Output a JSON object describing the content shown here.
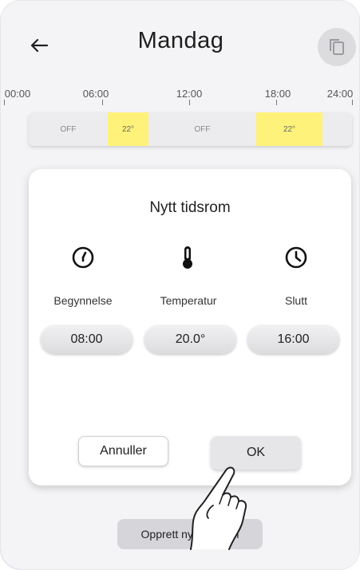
{
  "header": {
    "title": "Mandag"
  },
  "timeline": {
    "ticks": [
      "00:00",
      "06:00",
      "12:00",
      "18:00",
      "24:00"
    ],
    "segments": [
      {
        "label": "OFF",
        "state": "off"
      },
      {
        "label": "22°",
        "state": "on"
      },
      {
        "label": "OFF",
        "state": "off"
      },
      {
        "label": "22°",
        "state": "on"
      },
      {
        "label": "",
        "state": "off"
      }
    ]
  },
  "dialog": {
    "title": "Nytt tidsrom",
    "start": {
      "label": "Begynnelse",
      "value": "08:00",
      "icon": "clock-start-icon"
    },
    "temperature": {
      "label": "Temperatur",
      "value": "20.0°",
      "icon": "thermometer-icon"
    },
    "end": {
      "label": "Slutt",
      "value": "16:00",
      "icon": "clock-end-icon"
    },
    "cancel_label": "Annuller",
    "ok_label": "OK"
  },
  "footer": {
    "create_label": "Opprett nytt tidsrom"
  },
  "colors": {
    "active_segment": "#fff27a",
    "accent": "#7a6ce6"
  }
}
